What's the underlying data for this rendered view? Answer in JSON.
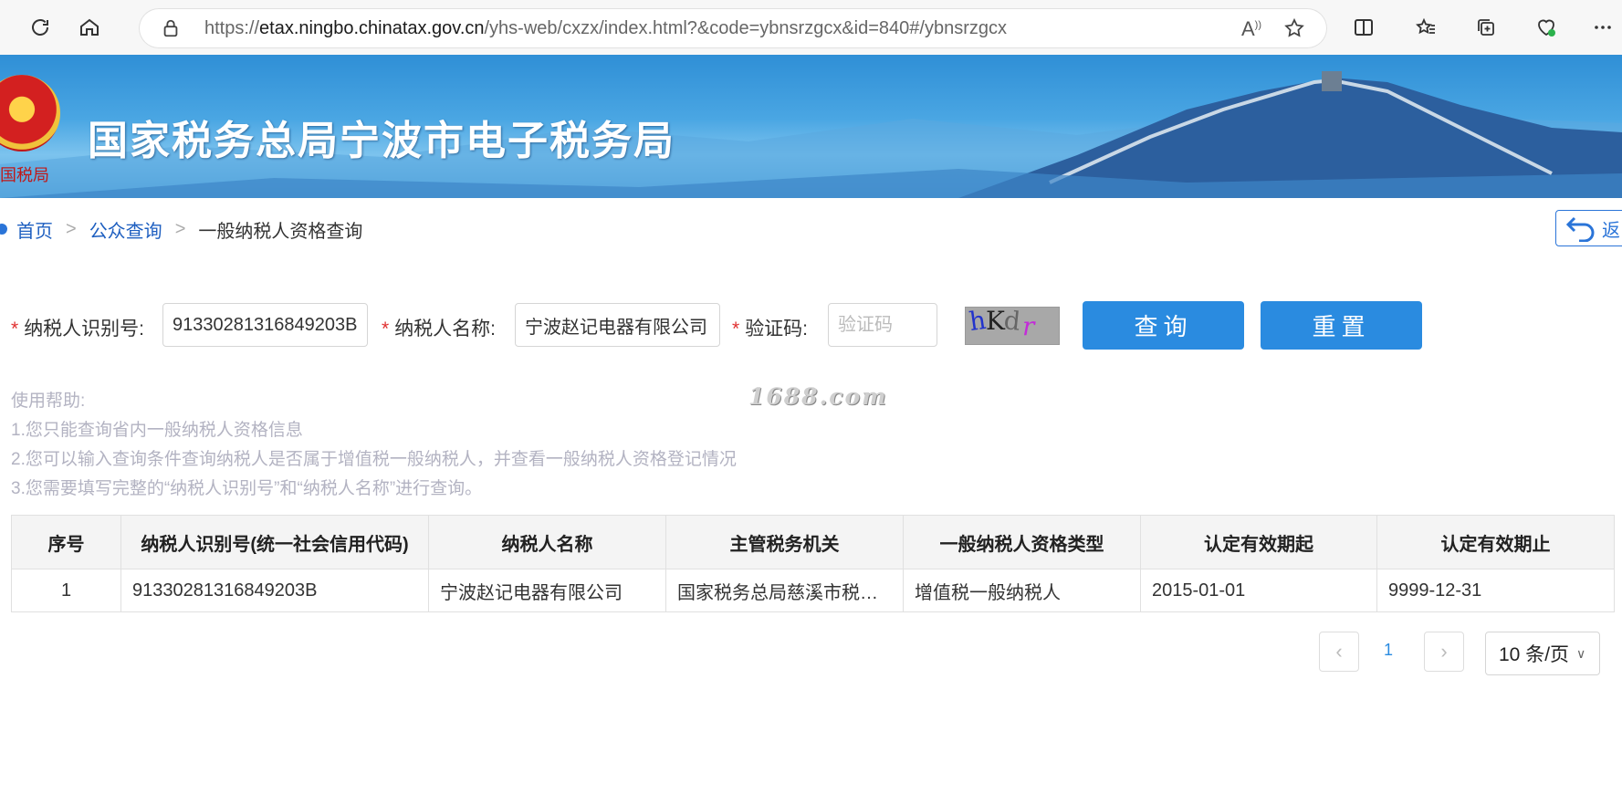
{
  "browser": {
    "url_prefix": "https://",
    "url_host": "etax.ningbo.chinatax.gov.cn",
    "url_path": "/yhs-web/cxzx/index.html?&code=ybnsrzgcx&id=840#/ybnsrzgcx",
    "read_aloud": "À́"
  },
  "banner": {
    "title": "国家税务总局宁波市电子税务局",
    "emblem_text": "国税局"
  },
  "breadcrumb": {
    "home": "首页",
    "public": "公众查询",
    "current": "一般纳税人资格查询",
    "sep": ">",
    "back_label": "返"
  },
  "form": {
    "taxpayer_id_label": "纳税人识别号:",
    "taxpayer_id_value": "91330281316849203B",
    "taxpayer_name_label": "纳税人名称:",
    "taxpayer_name_value": "宁波赵记电器有限公司",
    "captcha_label": "验证码:",
    "captcha_placeholder": "验证码",
    "captcha_chars": [
      "h",
      "K",
      "d",
      "r"
    ],
    "required_mark": "*",
    "query_button": "查询",
    "reset_button": "重置"
  },
  "help": {
    "title": "使用帮助:",
    "lines": [
      "1.您只能查询省内一般纳税人资格信息",
      "2.您可以输入查询条件查询纳税人是否属于增值税一般纳税人，并查看一般纳税人资格登记情况",
      "3.您需要填写完整的“纳税人识别号”和“纳税人名称”进行查询。"
    ],
    "watermark": "1688.com"
  },
  "table": {
    "headers": [
      "序号",
      "纳税人识别号(统一社会信用代码)",
      "纳税人名称",
      "主管税务机关",
      "一般纳税人资格类型",
      "认定有效期起",
      "认定有效期止"
    ],
    "rows": [
      [
        "1",
        "91330281316849203B",
        "宁波赵记电器有限公司",
        "国家税务总局慈溪市税务局",
        "增值税一般纳税人",
        "2015-01-01",
        "9999-12-31"
      ]
    ]
  },
  "pagination": {
    "prev": "‹",
    "page": "1",
    "next": "›",
    "page_size": "10 条/页"
  },
  "colors": {
    "accent": "#2a8be0",
    "link": "#1e5fc0",
    "required": "#e03030"
  }
}
